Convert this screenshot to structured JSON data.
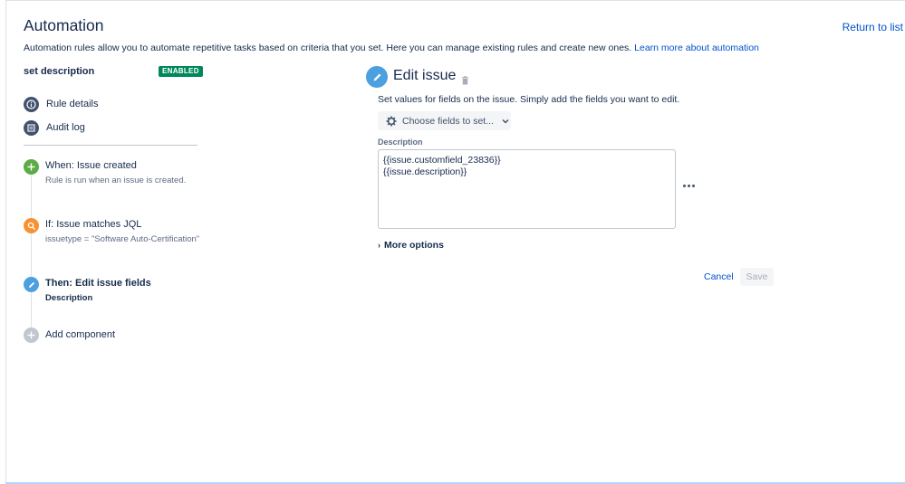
{
  "header": {
    "title": "Automation",
    "return_link": "Return to list",
    "description": "Automation rules allow you to automate repetitive tasks based on criteria that you set. Here you can manage existing rules and create new ones.",
    "learn_more": "Learn more about automation"
  },
  "rule": {
    "name": "set description",
    "status": "ENABLED",
    "status_color": "#00875a"
  },
  "nav": {
    "rule_details": "Rule details",
    "audit_log": "Audit log"
  },
  "steps": [
    {
      "title": "When: Issue created",
      "subtitle": "Rule is run when an issue is created.",
      "icon": "plus-icon",
      "color": "#5aac44"
    },
    {
      "title": "If: Issue matches JQL",
      "subtitle": "issuetype = \"Software Auto-Certification\"",
      "icon": "search-icon",
      "color": "#f79232"
    },
    {
      "title": "Then: Edit issue fields",
      "subtitle": "Description",
      "icon": "pencil-icon",
      "color": "#4ca0e0"
    },
    {
      "title": "Add component",
      "icon": "plus-icon",
      "color": "#c1c7d0"
    }
  ],
  "panel": {
    "title": "Edit issue",
    "description": "Set values for fields on the issue. Simply add the fields you want to edit.",
    "choose_fields": "Choose fields to set...",
    "field_label": "Description",
    "field_value_line1": "{{issue.customfield_23836}}",
    "field_value_line2": "{{issue.description}}",
    "more_options": "More options",
    "cancel": "Cancel",
    "save": "Save"
  }
}
